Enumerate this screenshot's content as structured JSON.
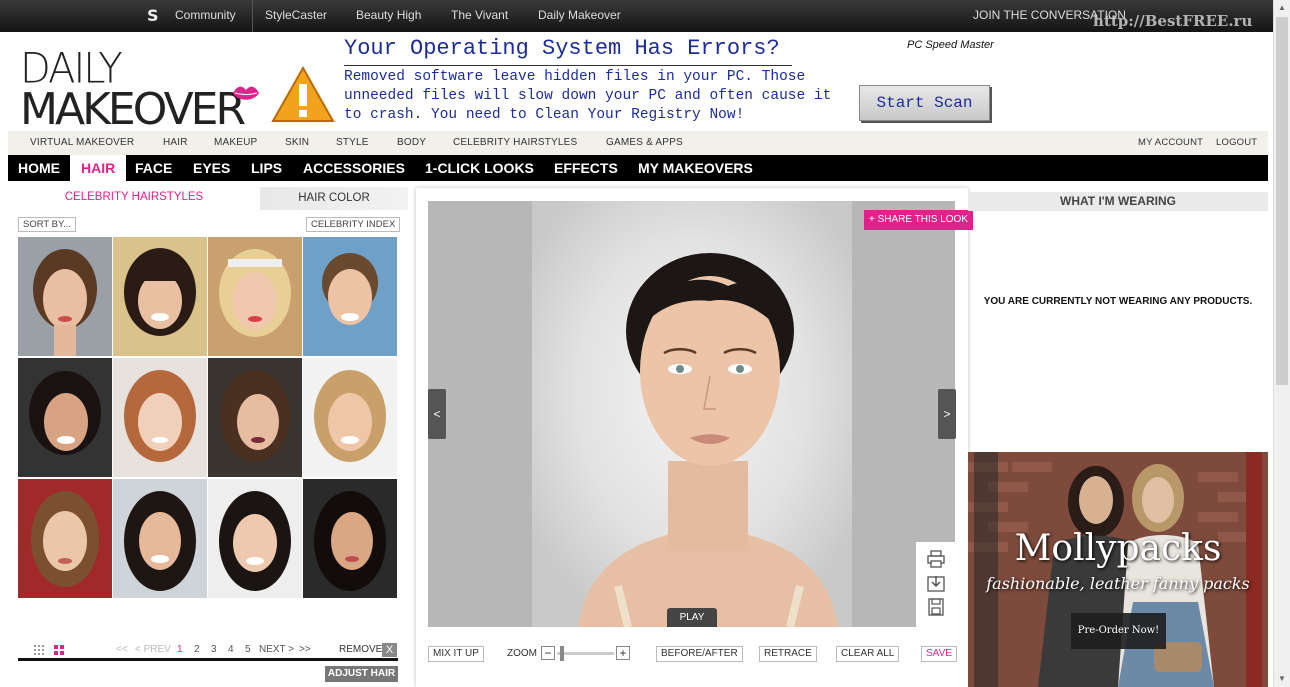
{
  "topbar": {
    "community": "Community",
    "links": [
      "StyleCaster",
      "Beauty High",
      "The Vivant",
      "Daily Makeover"
    ],
    "join": "JOIN THE CONVERSATION",
    "watermark": "http://BestFREE.ru"
  },
  "logo": {
    "line1": "DAILY",
    "line2": "MAKEOVER"
  },
  "ad": {
    "title": "Your Operating System Has Errors?",
    "body": "Removed software leave hidden files in your PC. Those unneeded files will slow down your PC and often cause it to crash. You need to Clean Your Registry Now!",
    "brand": "PC Speed Master",
    "button": "Start Scan"
  },
  "subnav": {
    "items": [
      "VIRTUAL MAKEOVER",
      "HAIR",
      "MAKEUP",
      "SKIN",
      "STYLE",
      "BODY",
      "CELEBRITY HAIRSTYLES",
      "GAMES & APPS"
    ],
    "account": "MY ACCOUNT",
    "logout": "LOGOUT"
  },
  "mainnav": {
    "items": [
      "HOME",
      "HAIR",
      "FACE",
      "EYES",
      "LIPS",
      "ACCESSORIES",
      "1-CLICK LOOKS",
      "EFFECTS",
      "MY MAKEOVERS"
    ],
    "active": "HAIR"
  },
  "left": {
    "tabs": [
      "CELEBRITY HAIRSTYLES",
      "HAIR COLOR"
    ],
    "sort": "SORT BY...",
    "index": "CELEBRITY INDEX",
    "pager": {
      "first": "<<",
      "prev": "< PREV",
      "pages": [
        "1",
        "2",
        "3",
        "4",
        "5"
      ],
      "current": "1",
      "next": "NEXT >",
      "last": ">>",
      "remove": "REMOVE",
      "remove_x": "X"
    },
    "adjust": "ADJUST HAIR"
  },
  "center": {
    "share": "+ SHARE THIS LOOK",
    "prev_arrow": "<",
    "next_arrow": ">",
    "play": "PLAY",
    "controls": {
      "mix": "MIX IT UP",
      "zoom": "ZOOM",
      "before_after": "BEFORE/AFTER",
      "retrace": "RETRACE",
      "clear": "CLEAR ALL",
      "save": "SAVE"
    }
  },
  "right": {
    "header": "WHAT I'M WEARING",
    "empty": "YOU ARE CURRENTLY NOT WEARING ANY PRODUCTS."
  },
  "molly": {
    "title": "Mollypacks",
    "subtitle": "fashionable, leather fanny packs",
    "button": "Pre-Order Now!"
  },
  "colors": {
    "accent_pink": "#e0238b",
    "ad_blue": "#1c2d9a",
    "nav_black": "#000000"
  }
}
